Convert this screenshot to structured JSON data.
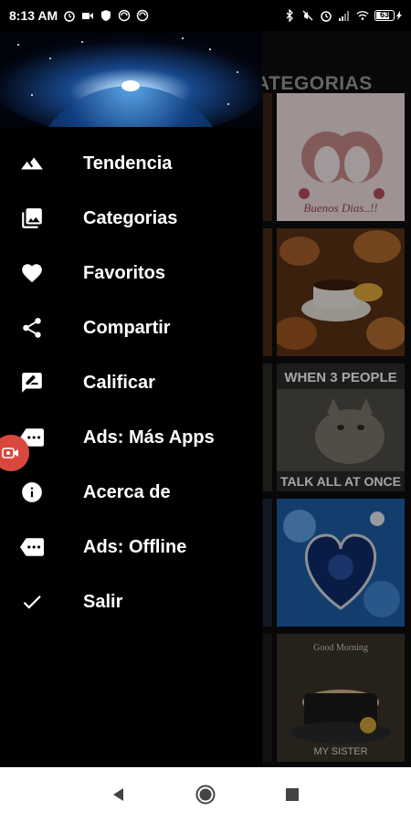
{
  "status_bar": {
    "time": "8:13 AM",
    "battery_level": "63"
  },
  "background": {
    "title": "ATEGORIAS"
  },
  "drawer": {
    "items": [
      {
        "label": "Tendencia",
        "icon": "landscape-icon"
      },
      {
        "label": "Categorias",
        "icon": "photo-library-icon"
      },
      {
        "label": "Favoritos",
        "icon": "heart-icon"
      },
      {
        "label": "Compartir",
        "icon": "share-icon"
      },
      {
        "label": "Calificar",
        "icon": "rate-review-icon"
      },
      {
        "label": "Ads: Más Apps",
        "icon": "more-label-icon"
      },
      {
        "label": "Acerca de",
        "icon": "info-icon"
      },
      {
        "label": "Ads: Offline",
        "icon": "more-label-icon"
      },
      {
        "label": "Salir",
        "icon": "check-icon"
      }
    ]
  },
  "thumbnails": [
    {
      "caption_top": "",
      "caption_bottom": "Buenos Dias..!!"
    },
    {
      "caption_top": "",
      "caption_bottom": ""
    },
    {
      "caption_top": "WHEN 3 PEOPLE",
      "caption_bottom": "TALK ALL AT ONCE"
    },
    {
      "caption_top": "",
      "caption_bottom": ""
    },
    {
      "caption_top": "Good Morning",
      "caption_bottom": "MY SISTER"
    }
  ],
  "colors": {
    "drawer_bg": "#000000",
    "floating_button": "#d8483c",
    "nav_bar": "#ffffff"
  }
}
